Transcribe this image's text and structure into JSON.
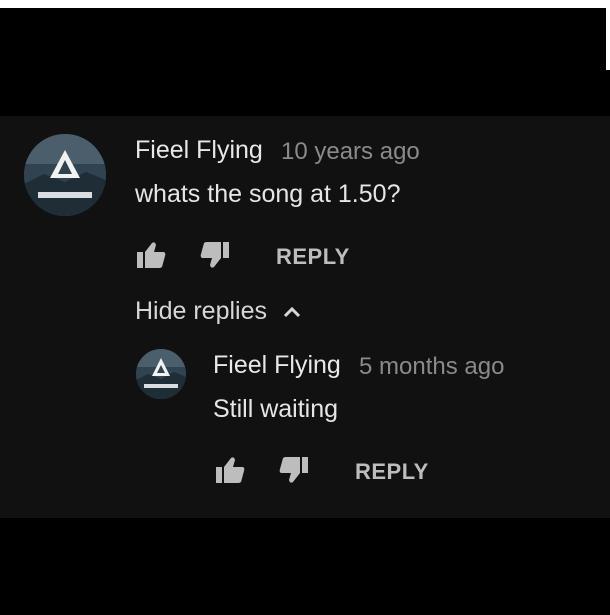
{
  "comment": {
    "author": "Fieel Flying",
    "timestamp": "10 years ago",
    "text": "whats the song at 1.50?",
    "reply_label": "REPLY"
  },
  "replies_toggle": {
    "label": "Hide replies"
  },
  "reply": {
    "author": "Fieel Flying",
    "timestamp": "5 months ago",
    "text": "Still waiting",
    "reply_label": "REPLY"
  },
  "colors": {
    "page_background": "#000000",
    "panel_background": "#111111",
    "author": "#e8e8e8",
    "timestamp": "#8a8a8a",
    "action": "#bdbdbd"
  },
  "icons": [
    "thumbs-up-icon",
    "thumbs-down-icon",
    "chevron-up-icon"
  ]
}
